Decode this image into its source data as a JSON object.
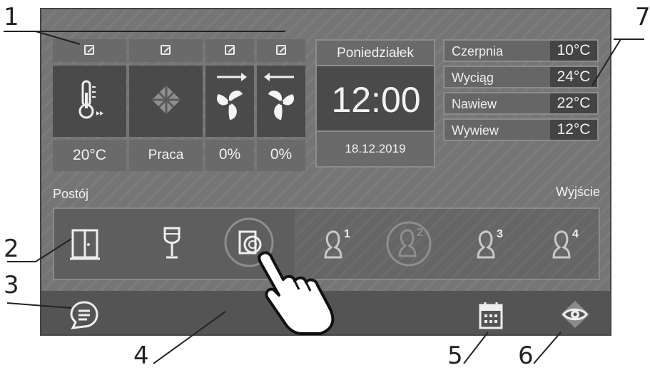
{
  "callouts": [
    "1",
    "2",
    "3",
    "4",
    "5",
    "6",
    "7"
  ],
  "top_tiles": [
    {
      "value": "20°C",
      "icon": "thermometer-icon"
    },
    {
      "value": "Praca",
      "icon": "heat-exchanger-icon"
    },
    {
      "value": "0%",
      "icon": "supply-fan-icon"
    },
    {
      "value": "0%",
      "icon": "exhaust-fan-icon"
    }
  ],
  "clock": {
    "day": "Poniedziałek",
    "time": "12:00",
    "date": "18.12.2019"
  },
  "sensors": [
    {
      "label": "Czerpnia",
      "value": "10°C"
    },
    {
      "label": "Wyciąg",
      "value": "24°C"
    },
    {
      "label": "Nawiew",
      "value": "22°C"
    },
    {
      "label": "Wywiew",
      "value": "12°C"
    }
  ],
  "modes": {
    "left_label": "Postój",
    "right_label": "Wyjście"
  },
  "profiles": [
    "1",
    "2",
    "3",
    "4"
  ],
  "icons": {
    "edit": "edit-icon",
    "door": "door-icon",
    "glass": "wine-glass-icon",
    "target": "door-target-icon",
    "user": "user-icon",
    "chat": "chat-icon",
    "calendar": "calendar-icon",
    "eye": "eye-icon",
    "hand": "pointing-hand-icon"
  },
  "colors": {
    "screen": "#757575",
    "tile": "#5a5a5a",
    "bar": "#545454",
    "text": "#f2f2f2"
  }
}
